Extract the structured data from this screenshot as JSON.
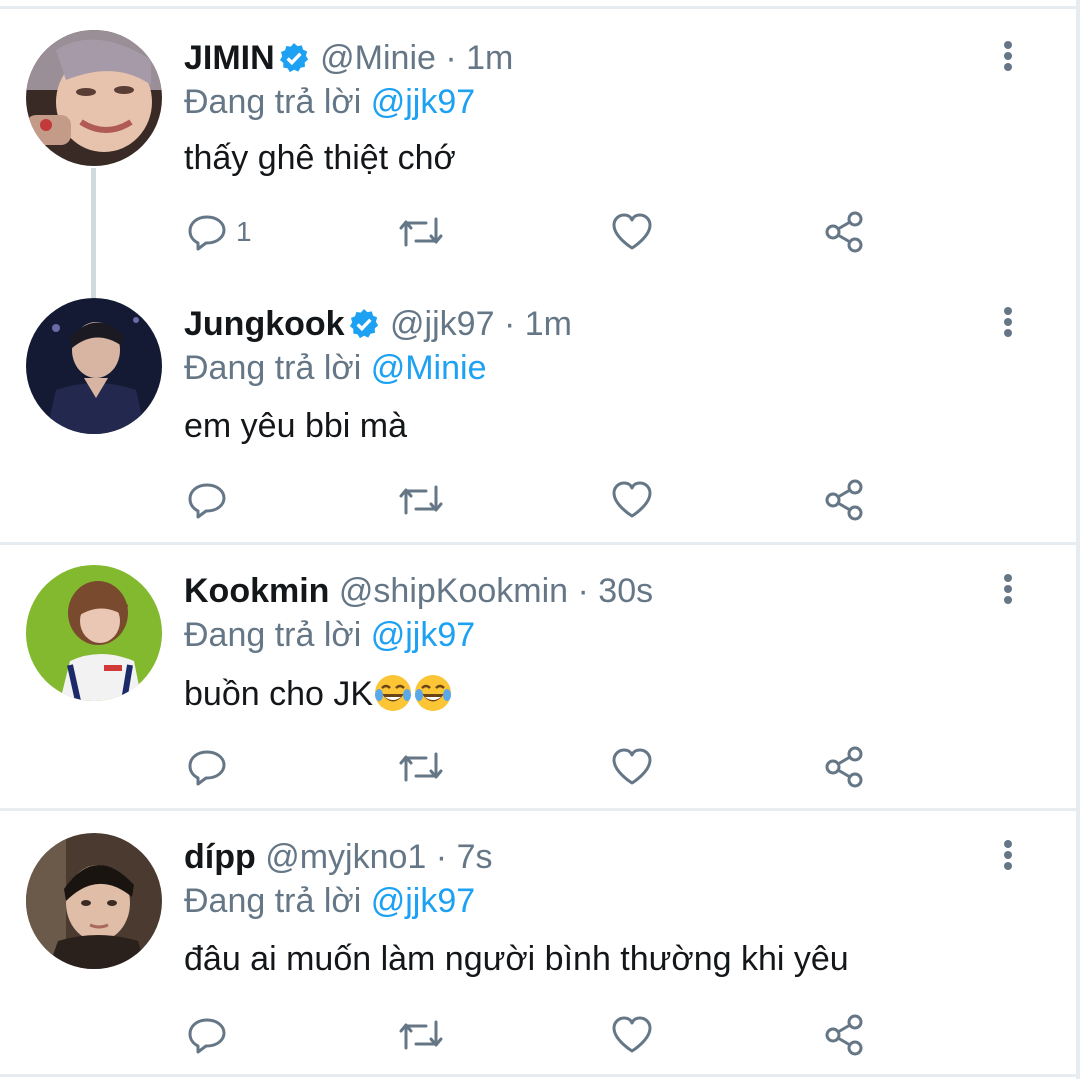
{
  "tweets": [
    {
      "name": "JIMIN",
      "verified": true,
      "handle": "@Minie",
      "time": "· 1m",
      "reply_prefix": "Đang trả lời",
      "reply_to": "@jjk97",
      "text": "thấy ghê thiệt chớ",
      "reply_count": "1"
    },
    {
      "name": "Jungkook",
      "verified": true,
      "handle": "@jjk97",
      "time": "· 1m",
      "reply_prefix": "Đang trả lời",
      "reply_to": "@Minie",
      "text": "em yêu bbi mà",
      "reply_count": ""
    },
    {
      "name": "Kookmin",
      "verified": false,
      "handle": "@shipKookmin",
      "time": "· 30s",
      "reply_prefix": "Đang trả lời",
      "reply_to": "@jjk97",
      "text": "buồn cho JK",
      "emoji": [
        "face-with-tears-of-joy",
        "face-with-tears-of-joy"
      ],
      "reply_count": ""
    },
    {
      "name": "dípp",
      "verified": false,
      "handle": "@myjkno1",
      "time": "· 7s",
      "reply_prefix": "Đang trả lời",
      "reply_to": "@jjk97",
      "text": "đâu ai muốn làm người bình thường khi yêu",
      "reply_count": ""
    }
  ],
  "colors": {
    "accent": "#1da1f2",
    "secondary_text": "#657786",
    "primary_text": "#14171a",
    "divider": "#e6ecf0"
  },
  "icons": [
    "reply-icon",
    "retweet-icon",
    "like-icon",
    "share-icon",
    "more-icon",
    "verified-badge-icon"
  ]
}
